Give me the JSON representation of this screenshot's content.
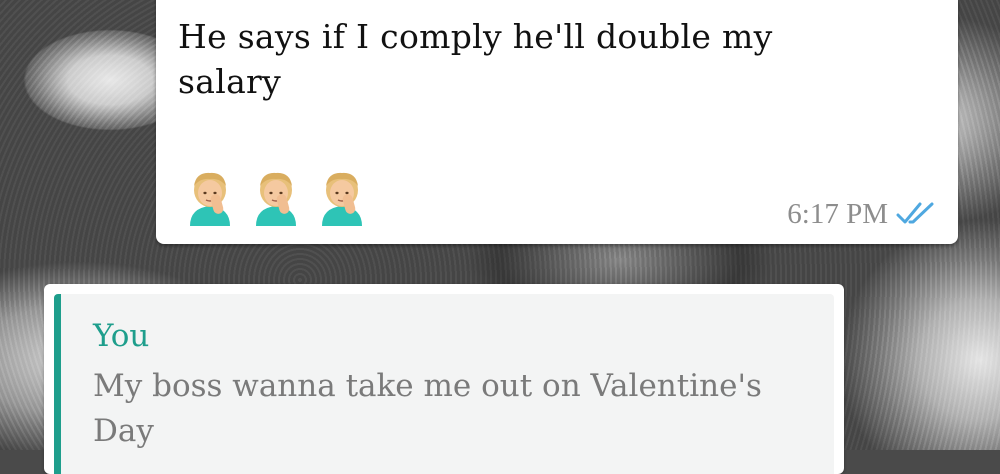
{
  "message": {
    "text": "He says if I comply he'll double my salary",
    "emojis": [
      "person-facepalming-emoji",
      "person-facepalming-emoji",
      "person-facepalming-emoji"
    ],
    "time": "6:17 PM",
    "status_icon": "double-check-read-icon",
    "status_color": "#4fa8e0"
  },
  "quoted": {
    "author": "You",
    "text": "My boss wanna take me out on Valentine's Day",
    "accent_color": "#1e9e8c"
  }
}
